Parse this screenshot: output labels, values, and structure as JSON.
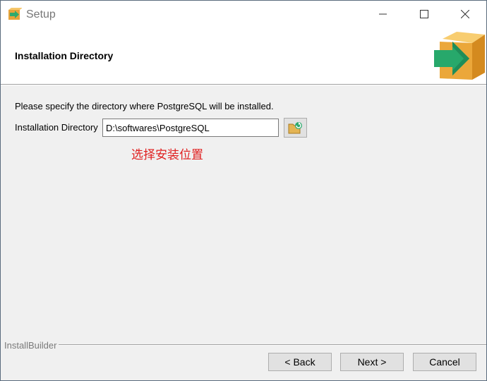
{
  "window": {
    "title": "Setup",
    "title_color": "#777777"
  },
  "header": {
    "title": "Installation Directory",
    "logo_icon": "installer-box-arrow-icon"
  },
  "content": {
    "description": "Please specify the directory where PostgreSQL will be installed.",
    "directory_label": "Installation Directory",
    "directory_value": "D:\\softwares\\PostgreSQL",
    "browse_icon": "folder-browse-icon",
    "annotation": "选择安装位置",
    "annotation_color": "#e02020"
  },
  "footer": {
    "brand": "InstallBuilder",
    "back_label": "< Back",
    "next_label": "Next >",
    "cancel_label": "Cancel"
  }
}
